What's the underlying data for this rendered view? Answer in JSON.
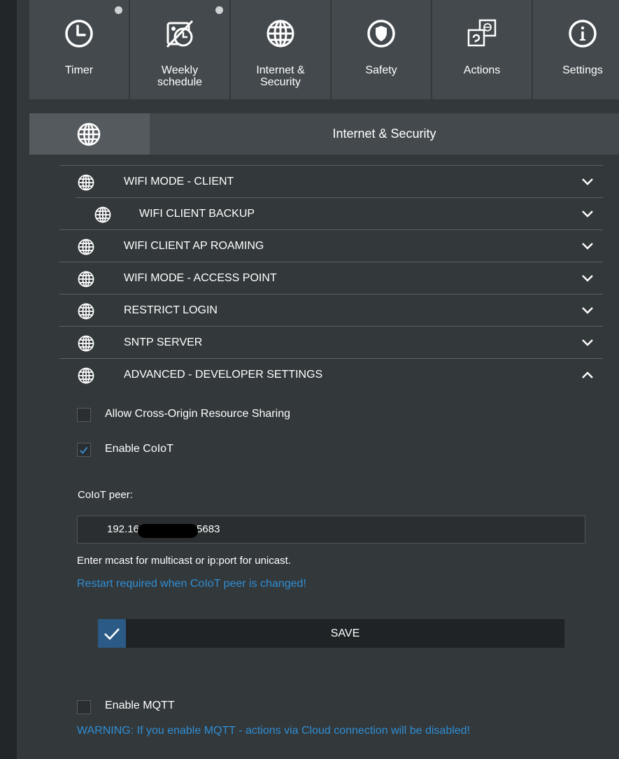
{
  "nav": {
    "tiles": [
      {
        "label": "Timer",
        "icon": "clock-icon",
        "dot": true
      },
      {
        "label": "Weekly schedule",
        "icon": "schedule-icon",
        "dot": true
      },
      {
        "label": "Internet & Security",
        "icon": "globe-icon",
        "dot": false
      },
      {
        "label": "Safety",
        "icon": "shield-icon",
        "dot": false
      },
      {
        "label": "Actions",
        "icon": "actions-icon",
        "dot": false
      },
      {
        "label": "Settings",
        "icon": "info-icon",
        "dot": false
      }
    ]
  },
  "section": {
    "title": "Internet & Security",
    "icon": "globe-icon"
  },
  "accordion": {
    "items": [
      {
        "label": "WIFI MODE - CLIENT",
        "expanded": false
      },
      {
        "label": "WIFI CLIENT BACKUP",
        "expanded": false
      },
      {
        "label": "WIFI CLIENT AP ROAMING",
        "expanded": false
      },
      {
        "label": "WIFI MODE - ACCESS POINT",
        "expanded": false
      },
      {
        "label": "RESTRICT LOGIN",
        "expanded": false
      },
      {
        "label": "SNTP SERVER",
        "expanded": false
      },
      {
        "label": "ADVANCED - DEVELOPER SETTINGS",
        "expanded": true
      }
    ]
  },
  "advanced": {
    "cors": {
      "label": "Allow Cross-Origin Resource Sharing",
      "checked": false
    },
    "coiot": {
      "label": "Enable CoIoT",
      "checked": true
    },
    "peer_label": "CoIoT peer:",
    "peer_value": "192.16",
    "peer_value_end": ".5683",
    "help_text": "Enter mcast for multicast or ip:port for unicast.",
    "restart_notice": "Restart required when CoIoT peer is changed!",
    "save_label": "SAVE",
    "mqtt": {
      "label": "Enable MQTT",
      "checked": false
    },
    "mqtt_warning": "WARNING: If you enable MQTT - actions via Cloud connection will be disabled!"
  },
  "colors": {
    "accent": "#2f8ed3",
    "save_check_bg": "#2a5a85",
    "panel": "#43494c",
    "background": "#33383b"
  }
}
